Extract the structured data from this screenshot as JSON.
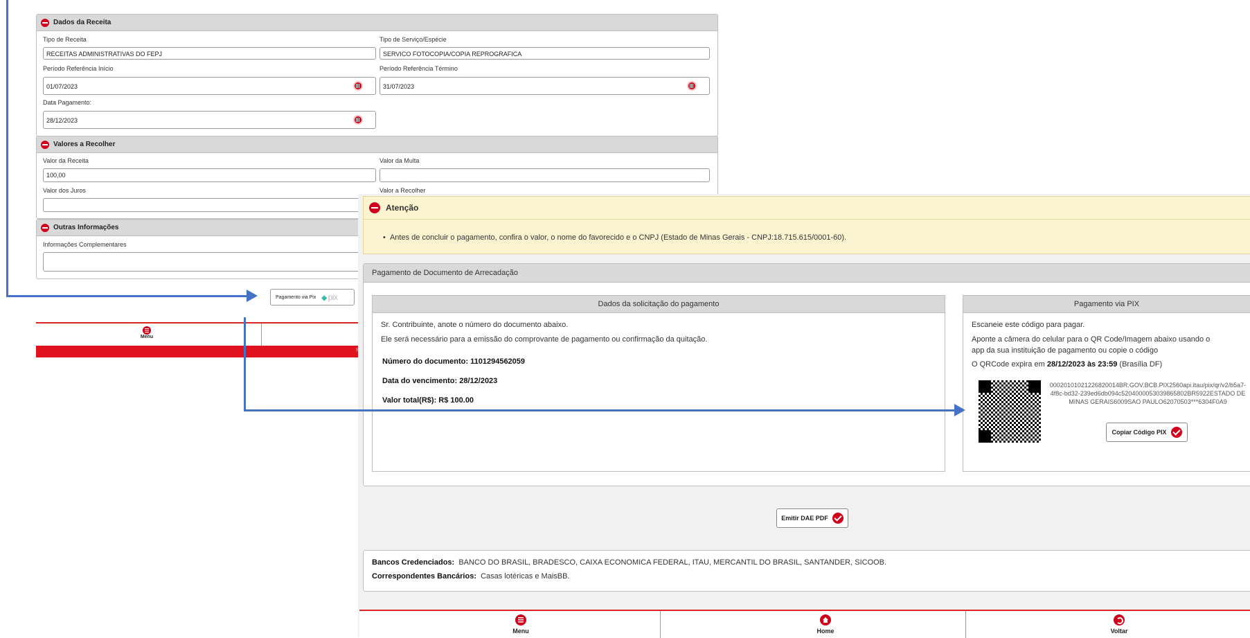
{
  "bg_form": {
    "dados_receita": {
      "title": "Dados da Receita",
      "tipo_receita_label": "Tipo de Receita",
      "tipo_receita_value": "RECEITAS ADMINISTRATIVAS DO FEPJ",
      "tipo_servico_label": "Tipo de Serviço/Espécie",
      "tipo_servico_value": "SERVICO FOTOCOPIA/COPIA REPROGRAFICA",
      "periodo_inicio_label": "Período Referência Início",
      "periodo_inicio_value": "01/07/2023",
      "periodo_termino_label": "Período Referência Término",
      "periodo_termino_value": "31/07/2023",
      "data_pagamento_label": "Data Pagamento:",
      "data_pagamento_value": "28/12/2023"
    },
    "valores": {
      "title": "Valores a Recolher",
      "valor_receita_label": "Valor da Receita",
      "valor_receita_value": "100,00",
      "valor_multa_label": "Valor da Multa",
      "valor_juros_label": "Valor dos Juros",
      "valor_recolher_label": "Valor a Recolher"
    },
    "outras": {
      "title": "Outras Informações",
      "info_label": "Informações Complementares"
    },
    "pix_button_label": "Pagamento via Pix",
    "pix_logo": "pix",
    "menu_label": "Menu",
    "red_bar_text": "SE"
  },
  "atencao": {
    "title": "Atenção",
    "message": "Antes de concluir o pagamento, confira o valor, o nome do favorecido e o CNPJ (Estado de Minas Gerais - CNPJ:18.715.615/0001-60)."
  },
  "pagamento": {
    "title": "Pagamento de Documento de Arrecadação",
    "dados_solicitacao": {
      "title": "Dados da solicitação do pagamento",
      "line1": "Sr. Contribuinte, anote o número do documento abaixo.",
      "line2": "Ele será necessário para a emissão do comprovante de pagamento ou confirmação da quitação.",
      "numero": "Número do documento: 1101294562059",
      "vencimento": "Data do vencimento: 28/12/2023",
      "valor_total": "Valor total(R$): R$ 100.00"
    },
    "pix": {
      "title": "Pagamento via PIX",
      "line1": "Escaneie este código para pagar.",
      "line2a": "Aponte a câmera do celular para o QR Code/Imagem abaixo usando o",
      "line2b": "app da sua instituição de pagamento ou copie o código",
      "expira_prefix": "O QRCode expira em ",
      "expira_data": "28/12/2023 às 23:59",
      "expira_suffix": " (Brasília DF)",
      "code_text": "00020101021226820014BR.GOV.BCB.PIX2560api.itau/pix/qr/v2/b5a7-4f8c-bd32-239ed6db094c5204000053039865802BR5922ESTADO DE MINAS GERAIS6009SAO PAULO62070503***6304F0A9",
      "copy_button": "Copiar Código PIX"
    }
  },
  "emitir_button": "Emitir DAE PDF",
  "bancos": {
    "label": "Bancos Credenciados:",
    "value": "BANCO DO BRASIL, BRADESCO, CAIXA ECONOMICA FEDERAL, ITAU, MERCANTIL DO BRASIL, SANTANDER, SICOOB.",
    "corresp_label": "Correspondentes Bancários:",
    "corresp_value": "Casas lotéricas e MaisBB."
  },
  "nav": {
    "menu": "Menu",
    "home": "Home",
    "voltar": "Voltar"
  },
  "colors": {
    "accent_red": "#d0021b",
    "arrow_blue": "#4472c4",
    "warning_bg": "#fcf4d0"
  }
}
